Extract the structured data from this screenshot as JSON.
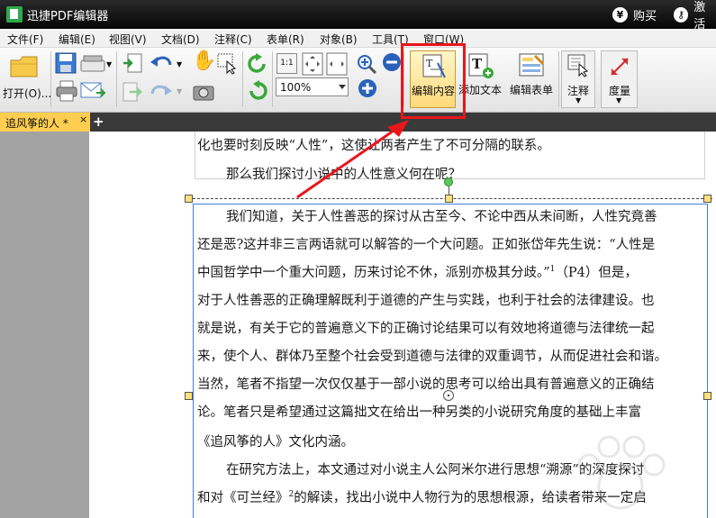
{
  "app": {
    "title": "迅捷PDF编辑器",
    "buy_label": "购买",
    "activate_label": "激活"
  },
  "menu": [
    "文件(F)",
    "编辑(E)",
    "视图(V)",
    "文档(D)",
    "注释(C)",
    "表单(R)",
    "对象(B)",
    "工具(T)",
    "窗口(W)"
  ],
  "toolbar": {
    "open_label": "打开(O)...",
    "zoom_value": "100%",
    "actual_size_label": "1:1",
    "edit_content_label": "编辑内容",
    "add_text_label": "添加文本",
    "edit_form_label": "编辑表单",
    "annotate_label": "注释",
    "measure_label": "度量"
  },
  "tabs": {
    "document_tab": "追风筝的人 *",
    "close_glyph": "×",
    "add_glyph": "+"
  },
  "document": {
    "prev_lines": [
      "化也要时刻反映“人性”，这使让两者产生了不可分隔的联系。",
      "那么我们探讨小说中的人性意义何在呢？"
    ],
    "lines": [
      "我们知道，关于人性善恶的探讨从古至今、不论中西从未间断，人性究竟善",
      "还是恶?这并非三言两语就可以解答的一个大问题。正如张岱年先生说：“人性是",
      "中国哲学中一个重大问题，历来讨论不休，派别亦极其分歧。”",
      "对于人性善恶的正确理解既利于道德的产生与实践，也利于社会的法律建设。也",
      "就是说，有关于它的普遍意义下的正确讨论结果可以有效地将道德与法律统一起",
      "来，使个人、群体乃至整个社会受到道德与法律的双重调节，从而促进社会和谐。",
      "当然，笔者不指望一次仅仅基于一部小说的思考可以给出具有普遍意义的正确结",
      "论。笔者只是希望通过这篇拙文在给出一种另类的小说研究角度的基础上丰富",
      "《追风筝的人》文化内涵。",
      "在研究方法上，本文通过对小说主人公阿米尔进行思想“溯源”的深度探讨",
      "和对《可兰经》",
      "的解读，找出小说中人物行为的思想根源，给读者带来一定启"
    ],
    "footnote_1": "1",
    "footnote_1_tail": "（P4）但是，",
    "footnote_2": "2"
  },
  "colors": {
    "highlight_border": "#e8161b",
    "selection_border": "#3f7fd8",
    "tab_active": "#ffce50"
  }
}
